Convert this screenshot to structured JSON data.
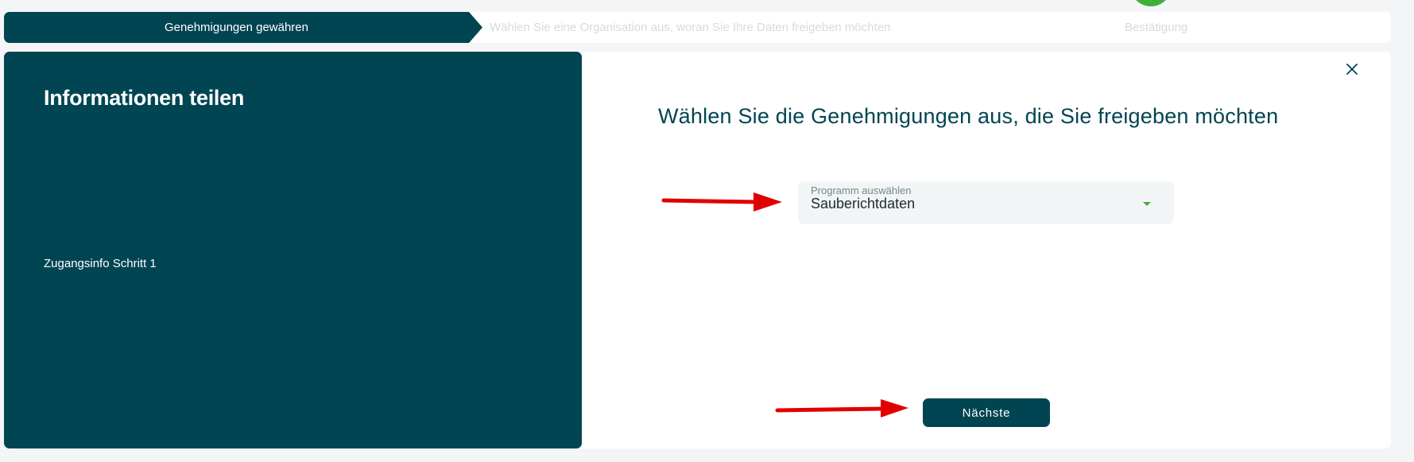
{
  "stepper": {
    "steps": [
      {
        "label": "Genehmigungen gewähren",
        "state": "active"
      },
      {
        "label": "Wählen Sie eine Organisation aus, woran Sie Ihre Daten freigeben möchten",
        "state": "upcoming"
      },
      {
        "label": "Bestätigung",
        "state": "upcoming"
      }
    ]
  },
  "left_panel": {
    "title": "Informationen teilen",
    "subtitle": "Zugangsinfo Schritt 1"
  },
  "main": {
    "heading": "Wählen Sie die Genehmigungen aus, die Sie freigeben möchten",
    "close_icon": "close-icon",
    "program_select": {
      "label": "Programm auswählen",
      "value": "Sauberichtdaten",
      "caret_icon": "caret-down-icon"
    },
    "next_button": {
      "label": "Nächste"
    }
  },
  "annotations": {
    "arrows": [
      "red-arrow-to-select",
      "red-arrow-to-next-button"
    ]
  },
  "colors": {
    "brand": "#014552",
    "accent_green": "#3fae3a",
    "annotation_red": "#e00000",
    "background": "#f3f5f6"
  }
}
